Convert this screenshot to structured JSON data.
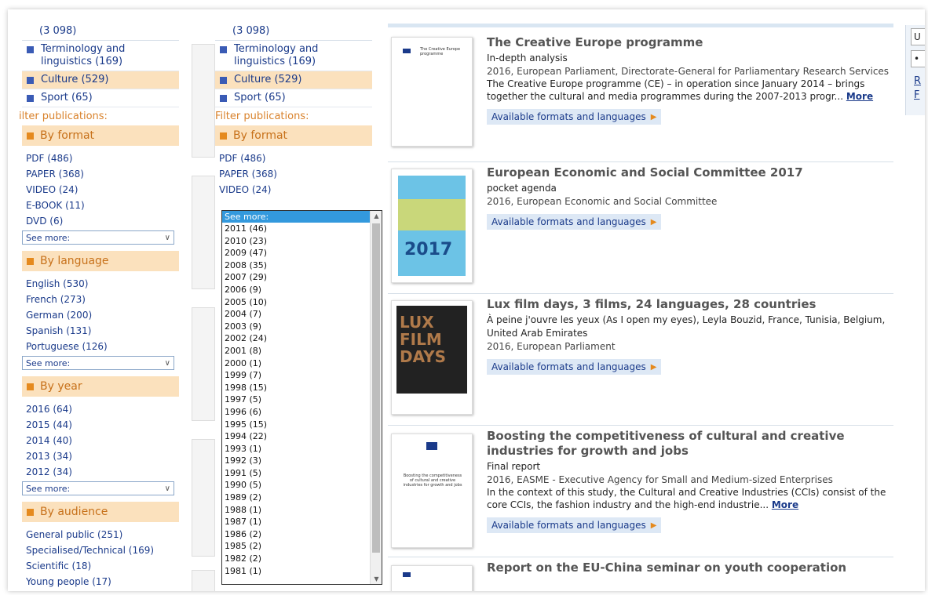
{
  "sidebar": {
    "count_top": "(3 098)",
    "categories": [
      {
        "label": "Terminology and linguistics (169)"
      },
      {
        "label": "Culture (529)"
      },
      {
        "label": "Sport (65)"
      }
    ],
    "filter_title": "Filter publications:",
    "filter_title_cut": "ilter publications:",
    "format": {
      "title": "By format",
      "items": [
        "PDF (486)",
        "PAPER (368)",
        "VIDEO (24)",
        "E-BOOK (11)",
        "DVD (6)"
      ],
      "select": "See more:"
    },
    "language": {
      "title": "By language",
      "items": [
        "English (530)",
        "French (273)",
        "German (200)",
        "Spanish (131)",
        "Portuguese (126)"
      ],
      "select": "See more:"
    },
    "year": {
      "title": "By year",
      "items": [
        "2016 (64)",
        "2015 (44)",
        "2014 (40)",
        "2013 (34)",
        "2012 (34)"
      ],
      "select": "See more:"
    },
    "audience": {
      "title": "By audience",
      "items": [
        "General public (251)",
        "Specialised/Technical (169)",
        "Scientific (18)",
        "Young people (17)"
      ]
    }
  },
  "dropdown": {
    "header": "See more:",
    "items": [
      "2011 (46)",
      "2010 (23)",
      "2009 (47)",
      "2008 (35)",
      "2007 (29)",
      "2006 (9)",
      "2005 (10)",
      "2004 (7)",
      "2003 (9)",
      "2002 (24)",
      "2001 (8)",
      "2000 (1)",
      "1999 (7)",
      "1998 (15)",
      "1997 (5)",
      "1996 (6)",
      "1995 (15)",
      "1994 (22)",
      "1993 (1)",
      "1992 (3)",
      "1991 (5)",
      "1990 (5)",
      "1989 (2)",
      "1988 (1)",
      "1987 (1)",
      "1986 (2)",
      "1985 (2)",
      "1982 (2)",
      "1981 (1)"
    ]
  },
  "results": [
    {
      "title": "The Creative Europe programme",
      "subtitle": "In-depth analysis",
      "meta": "2016, European Parliament, Directorate-General for Parliamentary Research Services",
      "desc": "The Creative Europe programme (CE) – in operation since January 2014 – brings together the cultural and media programmes during the 2007-2013 progr...",
      "more": "More",
      "formats": "Available formats and languages",
      "thumb_text": "The Creative Europe programme"
    },
    {
      "title": "European Economic and Social Committee 2017",
      "subtitle": "pocket agenda",
      "meta": "2016, European Economic and Social Committee",
      "desc": "",
      "more": "",
      "formats": "Available formats and languages",
      "thumb_text": "2017"
    },
    {
      "title": "Lux film days, 3 films, 24 languages, 28 countries",
      "subtitle": "À peine j'ouvre les yeux (As I open my eyes), Leyla Bouzid, France, Tunisia, Belgium, United Arab Emirates",
      "meta": "2016, European Parliament",
      "desc": "",
      "more": "",
      "formats": "Available formats and languages",
      "thumb_text": "LUX FILM DAYS"
    },
    {
      "title": "Boosting the competitiveness of cultural and creative industries for growth and jobs",
      "subtitle": "Final report",
      "meta": "2016, EASME - Executive Agency for Small and Medium-sized Enterprises",
      "desc": "In the context of this study, the Cultural and Creative Industries (CCIs) consist of the core CCIs, the fashion industry and the high-end industrie...",
      "more": "More",
      "formats": "Available formats and languages",
      "thumb_text": "Boosting the competitiveness of cultural and creative industries for growth and jobs"
    },
    {
      "title": "Report on the EU-China seminar on youth cooperation",
      "subtitle": "",
      "meta": "",
      "desc": "",
      "more": "",
      "formats": "",
      "thumb_text": ""
    }
  ],
  "right_panel": {
    "box1": "U",
    "box2": "•",
    "link1": "R",
    "link2": "F"
  },
  "colors": {
    "link_blue": "#1a3a8a",
    "section_bg": "#fbe1bd",
    "section_text": "#c7711a",
    "dropdown_highlight": "#3399dd"
  }
}
